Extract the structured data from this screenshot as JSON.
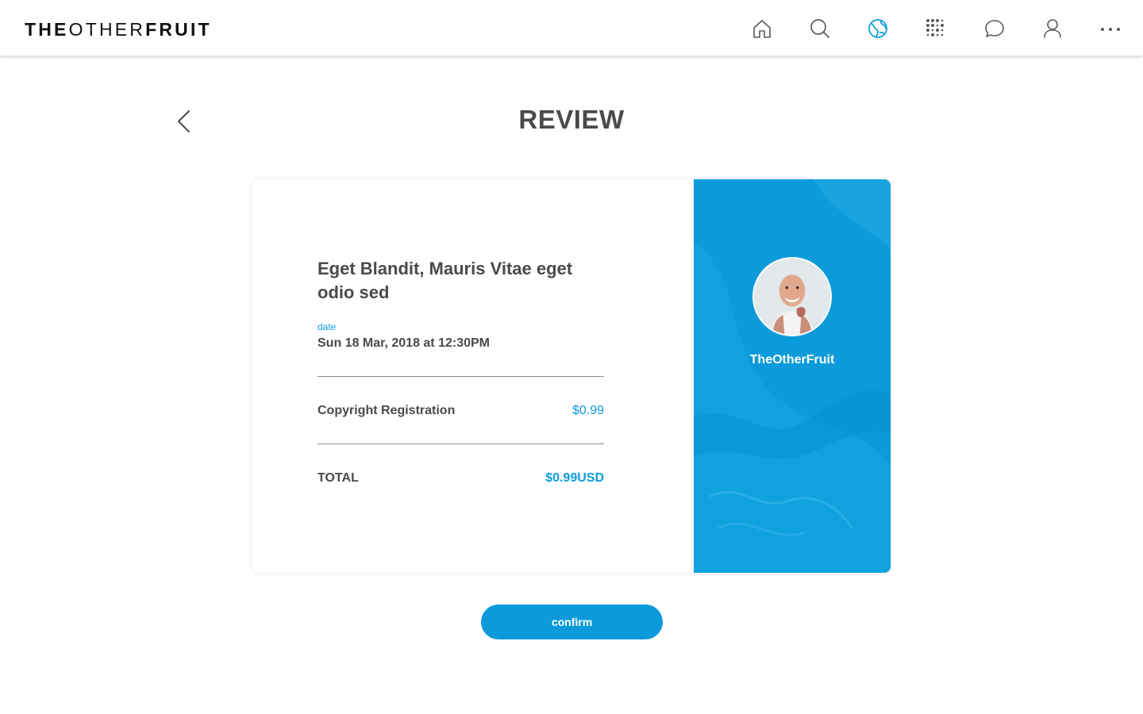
{
  "header": {
    "logo_bold_1": "THE",
    "logo_light": "OTHER",
    "logo_bold_2": "FRUIT",
    "nav_icons": [
      "home-icon",
      "search-icon",
      "globe-icon",
      "apps-grid-icon",
      "chat-icon",
      "profile-icon",
      "more-icon"
    ],
    "active_icon": "globe-icon",
    "accent_color": "#0b9bdb"
  },
  "page": {
    "title": "REVIEW"
  },
  "order": {
    "item_title": "Eget Blandit, Mauris Vitae eget odio sed",
    "date_label": "date",
    "date_value": "Sun 18 Mar, 2018 at 12:30PM",
    "line_item_label": "Copyright Registration",
    "line_item_price": "$0.99",
    "total_label": "TOTAL",
    "total_value": "$0.99USD"
  },
  "profile": {
    "name": "TheOtherFruit",
    "panel_color": "#0b9bdb"
  },
  "actions": {
    "confirm_label": "confirm"
  }
}
